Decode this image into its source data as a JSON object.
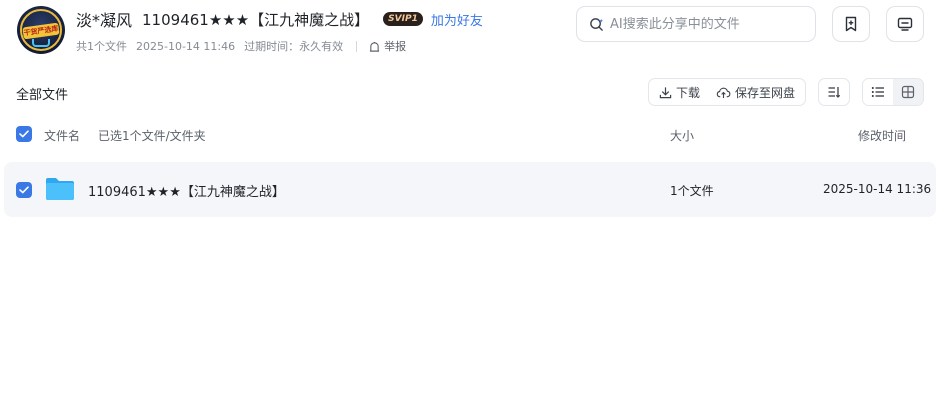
{
  "header": {
    "owner_name": "淡*凝风",
    "share_title": "1109461★★★【江九神魔之战】",
    "vip_badge": "SVIP1",
    "add_friend_label": "加为好友",
    "file_count": "共1个文件",
    "share_time": "2025-10-14 11:46",
    "expire_label": "过期时间：永久有效",
    "report_label": "举报",
    "avatar_text": "干货严选库"
  },
  "search": {
    "placeholder": "AI搜索此分享中的文件"
  },
  "toolbar": {
    "all_files_label": "全部文件",
    "download_label": "下载",
    "save_label": "保存至网盘"
  },
  "columns": {
    "name": "文件名",
    "selected": "已选1个文件/文件夹",
    "size": "大小",
    "mtime": "修改时间"
  },
  "files": [
    {
      "name": "1109461★★★【江九神魔之战】",
      "size": "1个文件",
      "mtime": "2025-10-14 11:36",
      "checked": true,
      "icon": "folder-icon"
    }
  ],
  "colors": {
    "accent": "#3a78e6",
    "folder": "#3fb6f6",
    "row_bg": "#f5f6f9"
  }
}
